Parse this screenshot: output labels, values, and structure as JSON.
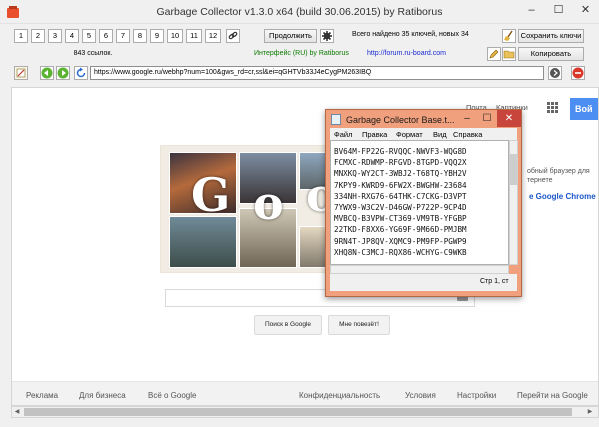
{
  "window": {
    "title": "Garbage Collector v1.3.0 x64 (build 30.06.2015) by Ratiborus",
    "minimize": "–",
    "maximize": "☐",
    "close": "✕"
  },
  "toolbar": {
    "page_buttons": [
      "1",
      "2",
      "3",
      "4",
      "5",
      "6",
      "7",
      "8",
      "9",
      "10",
      "11",
      "12"
    ],
    "links_count": "843 ссылок.",
    "continue_label": "Продолжить",
    "found_text": "Всего найдено 35 ключей, новых 34",
    "interface_text": "Интерфейс (RU) by Ratiborus",
    "forum_url": "http://forum.ru-board.com",
    "save_keys_label": "Сохранить ключи",
    "copy_label": "Копировать"
  },
  "navbar": {
    "url": "https://www.google.ru/webhp?num=100&gws_rd=cr,ssl&ei=qGHTVb33J4eCygPM263IBQ"
  },
  "google": {
    "mail": "Почта",
    "images": "Картинки",
    "signin": "Вой",
    "promo_text_1": "обный браузер для",
    "promo_text_2": "тернете",
    "promo_link": "e Google Chrome",
    "doodle_letters": [
      "G",
      "o",
      "o",
      "g",
      "l",
      "e"
    ],
    "search_button": "Поиск в Google",
    "lucky_button": "Мне повезёт!",
    "footer_left": [
      "Реклама",
      "Для бизнеса",
      "Всё о Google"
    ],
    "footer_right": [
      "Конфиденциальность",
      "Условия",
      "Настройки",
      "Перейти на Google"
    ]
  },
  "notepad": {
    "title": "Garbage Collector Base.t...",
    "menu": [
      "Файл",
      "Правка",
      "Формат",
      "Вид",
      "Справка"
    ],
    "keys": [
      "BV64M-FP22G-RVQQC-NWVF3-WQG8D",
      "FCMXC-RDWMP-RFGVD-8TGPD-VQQ2X",
      "MNXKQ-WY2CT-3WBJ2-T68TQ-YBH2V",
      "7KPY9-KWRD9-6FW2X-BWGHW-23684",
      "334NH-RXG76-64THK-C7CKG-D3VPT",
      "7YWX9-W3C2V-D46GW-P722P-9CP4D",
      "MVBCQ-B3VPW-CT369-VM9TB-YFGBP",
      "22TKD-F8XX6-YG69F-9M66D-PMJBM",
      "9RN4T-JP8QV-XQMC9-PM9FP-PGWP9",
      "XHQ8N-C3MCJ-RQX86-WCHYG-C9WKB"
    ],
    "status": "Стр 1, ст"
  }
}
